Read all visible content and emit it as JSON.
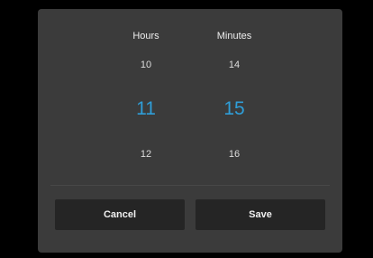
{
  "picker": {
    "hours": {
      "header": "Hours",
      "prev": "10",
      "selected": "11",
      "next": "12"
    },
    "minutes": {
      "header": "Minutes",
      "prev": "14",
      "selected": "15",
      "next": "16"
    }
  },
  "actions": {
    "cancel_label": "Cancel",
    "save_label": "Save"
  },
  "colors": {
    "accent": "#2f9ed8",
    "dialog_bg": "#3b3b3b",
    "button_bg": "#252525",
    "backdrop": "#000000"
  }
}
